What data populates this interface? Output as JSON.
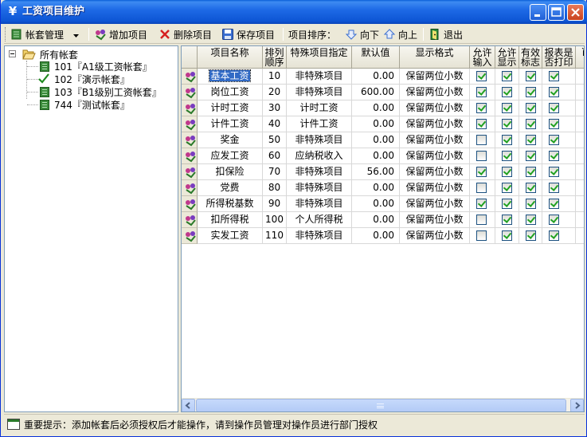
{
  "window": {
    "title": "工资项目维护",
    "title_icon": "yen-sign",
    "buttons": [
      "minimize",
      "maximize",
      "close"
    ]
  },
  "toolbar": {
    "account_menu": "帐套管理",
    "add_item": "增加项目",
    "delete_item": "删除项目",
    "save_item": "保存项目",
    "sort_label": "项目排序：",
    "move_down": "向下",
    "move_up": "向上",
    "exit": "退出"
  },
  "tree": {
    "root": "所有帐套",
    "items": [
      {
        "label": "101『A1级工资帐套』",
        "icon": "book-icon"
      },
      {
        "label": "102『演示帐套』",
        "icon": "check-icon",
        "active": true
      },
      {
        "label": "103『B1级别工资帐套』",
        "icon": "book-icon"
      },
      {
        "label": "744『测试帐套』",
        "icon": "book-icon"
      }
    ]
  },
  "grid": {
    "columns": [
      {
        "line1": "项目名称",
        "line2": ""
      },
      {
        "line1": "排列",
        "line2": "顺序"
      },
      {
        "line1": "特殊项目指定",
        "line2": ""
      },
      {
        "line1": "默认值",
        "line2": ""
      },
      {
        "line1": "显示格式",
        "line2": ""
      },
      {
        "line1": "允许",
        "line2": "输入"
      },
      {
        "line1": "允许",
        "line2": "显示"
      },
      {
        "line1": "有效",
        "line2": "标志"
      },
      {
        "line1": "报表是",
        "line2": "否打印"
      },
      {
        "line1": "ì",
        "line2": ""
      }
    ],
    "rows": [
      {
        "name": "基本工资",
        "order": "10",
        "special": "非特殊项目",
        "default": "0.00",
        "format": "保留两位小数",
        "input": true,
        "display": true,
        "valid": true,
        "print": true,
        "selected": true
      },
      {
        "name": "岗位工资",
        "order": "20",
        "special": "非特殊项目",
        "default": "600.00",
        "format": "保留两位小数",
        "input": true,
        "display": true,
        "valid": true,
        "print": true
      },
      {
        "name": "计时工资",
        "order": "30",
        "special": "计时工资",
        "default": "0.00",
        "format": "保留两位小数",
        "input": true,
        "display": true,
        "valid": true,
        "print": true
      },
      {
        "name": "计件工资",
        "order": "40",
        "special": "计件工资",
        "default": "0.00",
        "format": "保留两位小数",
        "input": true,
        "display": true,
        "valid": true,
        "print": true
      },
      {
        "name": "奖金",
        "order": "50",
        "special": "非特殊项目",
        "default": "0.00",
        "format": "保留两位小数",
        "input": false,
        "display": true,
        "valid": true,
        "print": true
      },
      {
        "name": "应发工资",
        "order": "60",
        "special": "应纳税收入",
        "default": "0.00",
        "format": "保留两位小数",
        "input": false,
        "display": true,
        "valid": true,
        "print": true
      },
      {
        "name": "扣保险",
        "order": "70",
        "special": "非特殊项目",
        "default": "56.00",
        "format": "保留两位小数",
        "input": true,
        "display": true,
        "valid": true,
        "print": true
      },
      {
        "name": "党费",
        "order": "80",
        "special": "非特殊项目",
        "default": "0.00",
        "format": "保留两位小数",
        "input": false,
        "display": true,
        "valid": true,
        "print": true
      },
      {
        "name": "所得税基数",
        "order": "90",
        "special": "非特殊项目",
        "default": "0.00",
        "format": "保留两位小数",
        "input": true,
        "display": true,
        "valid": true,
        "print": true
      },
      {
        "name": "扣所得税",
        "order": "100",
        "special": "个人所得税",
        "default": "0.00",
        "format": "保留两位小数",
        "input": false,
        "display": true,
        "valid": true,
        "print": true
      },
      {
        "name": "实发工资",
        "order": "110",
        "special": "非特殊项目",
        "default": "0.00",
        "format": "保留两位小数",
        "input": false,
        "display": true,
        "valid": true,
        "print": true
      }
    ]
  },
  "status": {
    "text": "重要提示：添加帐套后必须授权后才能操作，请到操作员管理对操作员进行部门授权"
  },
  "colors": {
    "title_bar": "#0d55d4",
    "selection": "#316ac5",
    "check": "#21a121"
  }
}
